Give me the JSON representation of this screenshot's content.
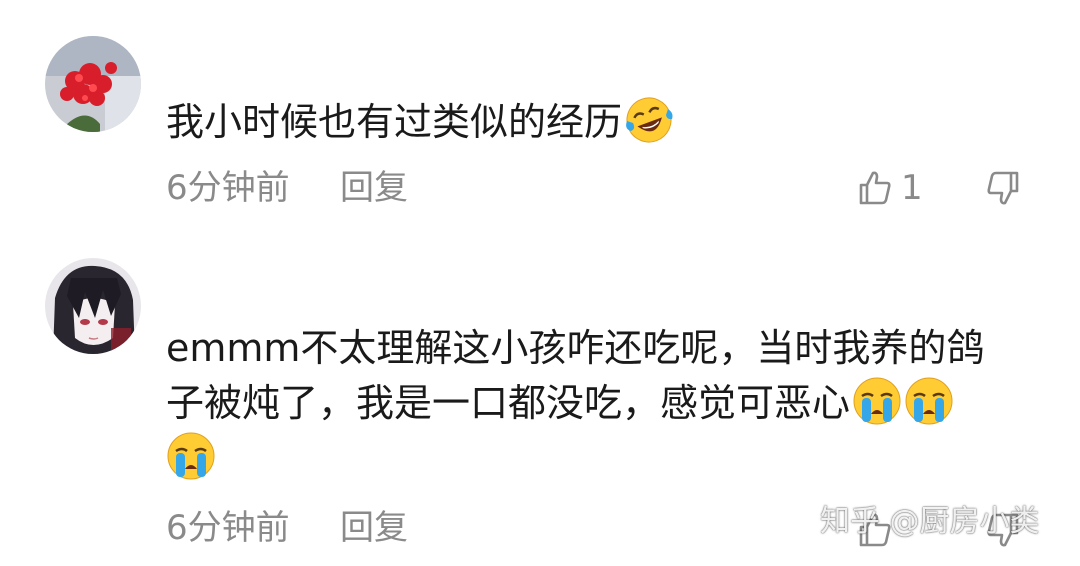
{
  "comments": [
    {
      "avatar_icon": "red-flower-avatar",
      "lines": [
        "我小时候也有过类似的经历"
      ],
      "line_emojis": [
        [
          "laugh-cry-emoji"
        ]
      ],
      "time": "6分钟前",
      "reply_label": "回复",
      "like_count": "1",
      "like_icon": "thumbs-up-icon",
      "dislike_icon": "thumbs-down-icon"
    },
    {
      "avatar_icon": "anime-boy-avatar",
      "lines": [
        "emmm不太理解这小孩咋还吃呢，当时我养的鸽",
        "子被炖了，我是一口都没吃，感觉可恶心",
        ""
      ],
      "line_emojis": [
        [],
        [
          "crying-emoji",
          "crying-emoji"
        ],
        [
          "crying-emoji"
        ]
      ],
      "time": "6分钟前",
      "reply_label": "回复",
      "like_icon": "thumbs-up-icon",
      "dislike_icon": "thumbs-down-icon"
    }
  ],
  "watermark": "知乎 @厨房小类",
  "colors": {
    "text": "#1a1a1a",
    "meta": "#8a8a8a",
    "background": "#ffffff",
    "emoji_face": "#ffcc33",
    "emoji_tear": "#35a7e8"
  }
}
